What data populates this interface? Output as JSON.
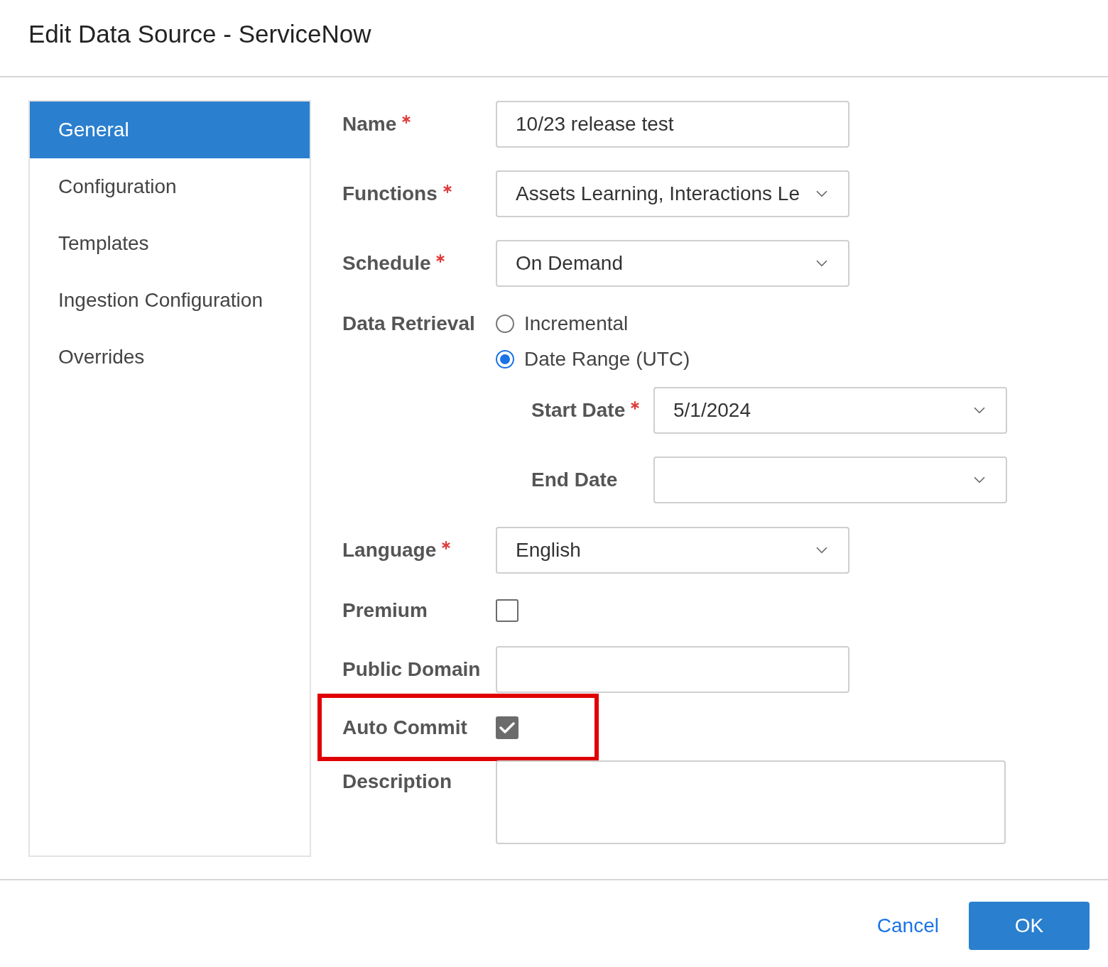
{
  "dialog": {
    "title": "Edit Data Source - ServiceNow"
  },
  "sidebar": {
    "items": [
      {
        "label": "General",
        "selected": true
      },
      {
        "label": "Configuration",
        "selected": false
      },
      {
        "label": "Templates",
        "selected": false
      },
      {
        "label": "Ingestion Configuration",
        "selected": false
      },
      {
        "label": "Overrides",
        "selected": false
      }
    ]
  },
  "fields": [
    {
      "kind": "text",
      "label": "Name",
      "required": true,
      "value": "10/23 release test"
    },
    {
      "kind": "select",
      "label": "Functions",
      "required": true,
      "value": "Assets Learning, Interactions Le"
    },
    {
      "kind": "select",
      "label": "Schedule",
      "required": true,
      "value": "On Demand"
    },
    {
      "kind": "radio",
      "label": "Data Retrieval",
      "required": false,
      "options": [
        {
          "label": "Incremental",
          "selected": false
        },
        {
          "label": "Date Range (UTC)",
          "selected": true
        }
      ],
      "subfields": [
        {
          "kind": "select",
          "label": "Start Date",
          "required": true,
          "value": "5/1/2024"
        },
        {
          "kind": "select",
          "label": "End Date",
          "required": false
        }
      ]
    },
    {
      "kind": "select",
      "label": "Language",
      "required": true,
      "value": "English"
    },
    {
      "kind": "checkbox",
      "label": "Premium",
      "required": false,
      "checked": false
    },
    {
      "kind": "text",
      "label": "Public Domain",
      "required": false
    },
    {
      "kind": "checkbox",
      "label": "Auto Commit",
      "required": false,
      "checked": true,
      "highlighted": true
    },
    {
      "kind": "textarea",
      "label": "Description",
      "required": false
    }
  ],
  "footer": {
    "buttons": [
      {
        "label": "Cancel",
        "kind": "link"
      },
      {
        "label": "OK",
        "kind": "primary"
      }
    ]
  }
}
